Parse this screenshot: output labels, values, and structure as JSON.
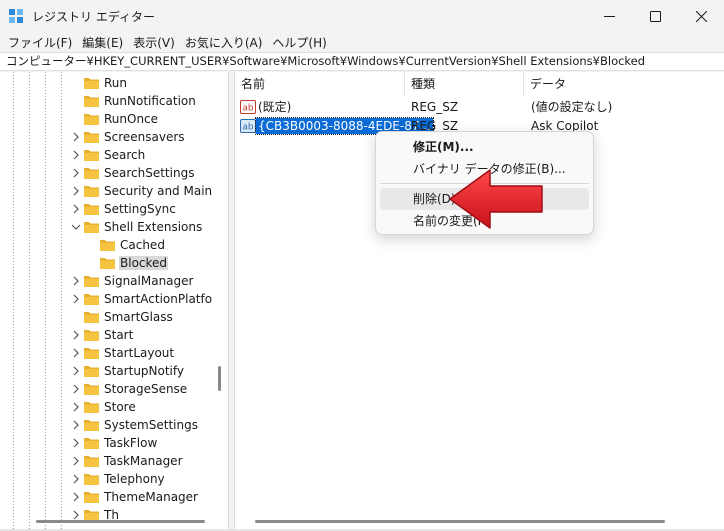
{
  "window": {
    "title": "レジストリ エディター",
    "icon": "registry-editor-icon",
    "controls": [
      "minimize-icon",
      "maximize-icon",
      "close-icon"
    ]
  },
  "menu": [
    "ファイル(F)",
    "編集(E)",
    "表示(V)",
    "お気に入り(A)",
    "ヘルプ(H)"
  ],
  "address": "コンピューター¥HKEY_CURRENT_USER¥Software¥Microsoft¥Windows¥CurrentVersion¥Shell Extensions¥Blocked",
  "tree": {
    "items": [
      {
        "label": "Run",
        "expander": "none",
        "level": 1
      },
      {
        "label": "RunNotification",
        "expander": "none",
        "level": 1
      },
      {
        "label": "RunOnce",
        "expander": "none",
        "level": 1
      },
      {
        "label": "Screensavers",
        "expander": "collapsed",
        "level": 1
      },
      {
        "label": "Search",
        "expander": "collapsed",
        "level": 1
      },
      {
        "label": "SearchSettings",
        "expander": "collapsed",
        "level": 1
      },
      {
        "label": "Security and Mainte",
        "expander": "collapsed",
        "level": 1
      },
      {
        "label": "SettingSync",
        "expander": "collapsed",
        "level": 1
      },
      {
        "label": "Shell Extensions",
        "expander": "expanded",
        "level": 1
      },
      {
        "label": "Cached",
        "expander": "none",
        "level": 2
      },
      {
        "label": "Blocked",
        "expander": "none",
        "level": 2,
        "selected": true
      },
      {
        "label": "SignalManager",
        "expander": "collapsed",
        "level": 1
      },
      {
        "label": "SmartActionPlatform",
        "expander": "collapsed",
        "level": 1
      },
      {
        "label": "SmartGlass",
        "expander": "none",
        "level": 1
      },
      {
        "label": "Start",
        "expander": "collapsed",
        "level": 1
      },
      {
        "label": "StartLayout",
        "expander": "collapsed",
        "level": 1
      },
      {
        "label": "StartupNotify",
        "expander": "collapsed",
        "level": 1
      },
      {
        "label": "StorageSense",
        "expander": "collapsed",
        "level": 1
      },
      {
        "label": "Store",
        "expander": "collapsed",
        "level": 1
      },
      {
        "label": "SystemSettings",
        "expander": "collapsed",
        "level": 1
      },
      {
        "label": "TaskFlow",
        "expander": "collapsed",
        "level": 1
      },
      {
        "label": "TaskManager",
        "expander": "collapsed",
        "level": 1
      },
      {
        "label": "Telephony",
        "expander": "collapsed",
        "level": 1
      },
      {
        "label": "ThemeManager",
        "expander": "collapsed",
        "level": 1
      },
      {
        "label": "Th",
        "expander": "collapsed",
        "level": 1
      }
    ]
  },
  "list": {
    "columns": [
      "名前",
      "種類",
      "データ"
    ],
    "rows": [
      {
        "name": "(既定)",
        "type": "REG_SZ",
        "data": "(値の設定なし)",
        "selected": false
      },
      {
        "name": "{CB3B0003-8088-4EDE-87...",
        "type": "REG_SZ",
        "data": "Ask Copilot",
        "selected": true
      }
    ]
  },
  "context_menu": {
    "items": [
      {
        "label": "修正(M)...",
        "bold": true
      },
      {
        "label": "バイナリ データの修正(B)...",
        "bold": false
      },
      {
        "label": "削除(D)",
        "bold": false,
        "hover": true
      },
      {
        "label": "名前の変更(R)",
        "bold": false
      }
    ]
  },
  "colors": {
    "accent": "#0a6bd6",
    "folder": "#f5c542",
    "arrow": "#e01e23"
  }
}
